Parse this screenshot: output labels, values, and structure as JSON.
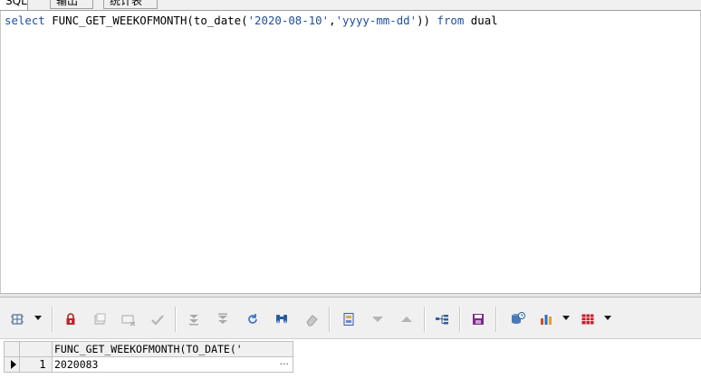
{
  "tabs": [
    {
      "label": "SQL",
      "active": true
    },
    {
      "label": "输出",
      "active": false
    },
    {
      "label": "统计表",
      "active": false
    }
  ],
  "editor": {
    "kw_select": "select",
    "func_part": " FUNC_GET_WEEKOFMONTH(to_date(",
    "str_date": "'2020-08-10'",
    "comma": ",",
    "str_fmt": "'yyyy-mm-dd'",
    "close": ")) ",
    "kw_from": "from",
    "table": " dual"
  },
  "toolbar": {
    "icons": [
      "grid-options-icon",
      "lock-icon",
      "add-record-icon",
      "delete-record-icon",
      "post-changes-icon",
      "first-record-icon",
      "last-record-icon",
      "refresh-icon",
      "find-icon",
      "clear-icon",
      "save-doc-icon",
      "next-record-icon",
      "prev-record-icon",
      "tree-view-icon",
      "save-icon",
      "query-icon",
      "chart-icon",
      "table-view-icon"
    ]
  },
  "results": {
    "columns": [
      "FUNC_GET_WEEKOFMONTH(TO_DATE('"
    ],
    "rows": [
      {
        "num": "1",
        "values": [
          "2020083"
        ],
        "more": "..."
      }
    ]
  },
  "colors": {
    "keyword": "#1f4f9f",
    "toolbar_bg": "#f0f0f0",
    "editor_bg": "#ffffff"
  }
}
